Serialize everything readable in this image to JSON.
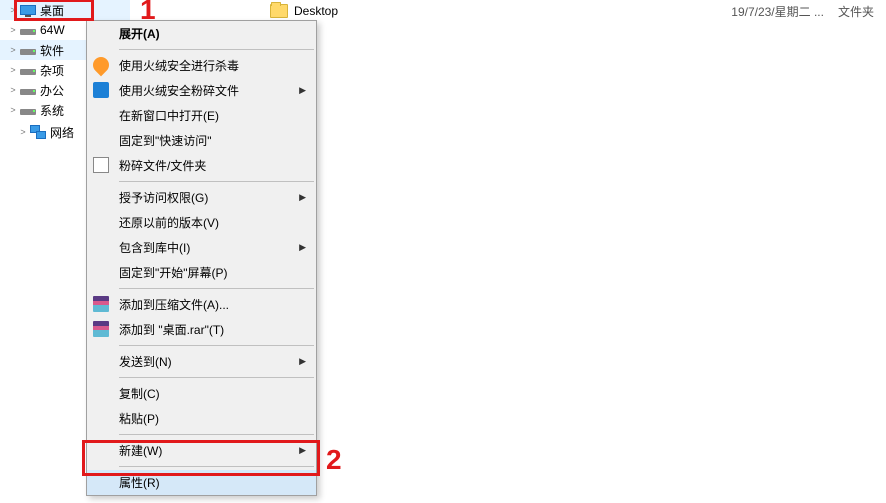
{
  "tree": {
    "items": [
      {
        "label": "桌面",
        "icon": "monitor",
        "highlight": true
      },
      {
        "label": "64W",
        "icon": "drive",
        "highlight": false
      },
      {
        "label": "软件",
        "icon": "drive",
        "highlight": true
      },
      {
        "label": "杂项",
        "icon": "drive",
        "highlight": false
      },
      {
        "label": "办公",
        "icon": "drive",
        "highlight": false
      },
      {
        "label": "系统",
        "icon": "drive",
        "highlight": false
      }
    ],
    "network_label": "网络"
  },
  "content": {
    "folder_name": "Desktop",
    "date": "19/7/23/星期二 ...",
    "type": "文件夹"
  },
  "context_menu": {
    "groups": [
      [
        {
          "label": "展开(A)",
          "bold": true
        }
      ],
      [
        {
          "label": "使用火绒安全进行杀毒",
          "icon": "flame"
        },
        {
          "label": "使用火绒安全粉碎文件",
          "icon": "shred",
          "submenu": true
        },
        {
          "label": "在新窗口中打开(E)"
        },
        {
          "label": "固定到\"快速访问\""
        },
        {
          "label": "粉碎文件/文件夹",
          "icon": "shreddoc"
        }
      ],
      [
        {
          "label": "授予访问权限(G)",
          "submenu": true
        },
        {
          "label": "还原以前的版本(V)"
        },
        {
          "label": "包含到库中(I)",
          "submenu": true
        },
        {
          "label": "固定到\"开始\"屏幕(P)"
        }
      ],
      [
        {
          "label": "添加到压缩文件(A)...",
          "icon": "rar"
        },
        {
          "label": "添加到 \"桌面.rar\"(T)",
          "icon": "rar"
        }
      ],
      [
        {
          "label": "发送到(N)",
          "submenu": true
        }
      ],
      [
        {
          "label": "复制(C)"
        },
        {
          "label": "粘贴(P)"
        }
      ],
      [
        {
          "label": "新建(W)",
          "submenu": true
        }
      ],
      [
        {
          "label": "属性(R)",
          "hover": true
        }
      ]
    ]
  },
  "annotations": {
    "one": "1",
    "two": "2"
  }
}
